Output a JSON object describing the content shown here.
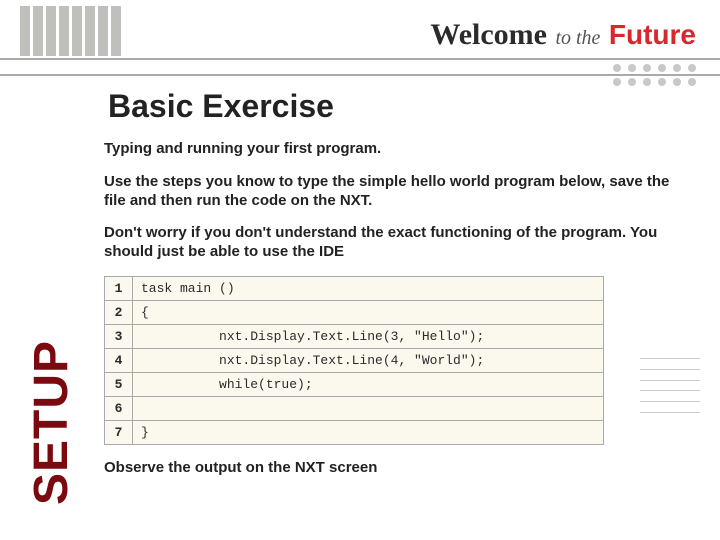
{
  "brand": {
    "welcome": "Welcome",
    "tothe": "to the",
    "future": "Future"
  },
  "title": "Basic Exercise",
  "setup_label": "SETUP",
  "body": {
    "p1": "Typing and running your first program.",
    "p2": "Use the steps you know to type the simple hello world program below, save the file and then run the code on the NXT.",
    "p3": "Don't worry if you don't understand the exact functioning of the program. You should just be able to use the IDE",
    "p4": "Observe the output on the NXT screen"
  },
  "code": {
    "rows": [
      {
        "n": "1",
        "text": "task main ()"
      },
      {
        "n": "2",
        "text": "{"
      },
      {
        "n": "3",
        "text": "          nxt.Display.Text.Line(3, \"Hello\");"
      },
      {
        "n": "4",
        "text": "          nxt.Display.Text.Line(4, \"World\");"
      },
      {
        "n": "5",
        "text": "          while(true);"
      },
      {
        "n": "6",
        "text": ""
      },
      {
        "n": "7",
        "text": "}"
      }
    ]
  }
}
